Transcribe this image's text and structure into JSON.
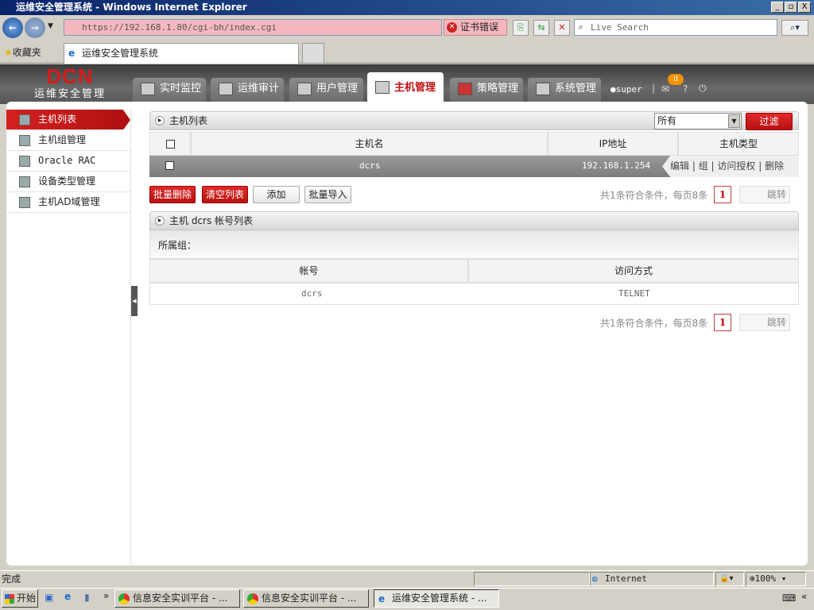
{
  "window": {
    "title": "运维安全管理系统 - Windows Internet Explorer",
    "min": "_",
    "max": "▫",
    "close": "X"
  },
  "browser": {
    "url": "https://192.168.1.80/cgi-bh/index.cgi",
    "cert_error": "证书错误",
    "search_placeholder": "Live Search",
    "favorites": "收藏夹",
    "tab_title": "运维安全管理系统"
  },
  "app": {
    "logo": "DCN",
    "subtitle": "运维安全管理",
    "nav": [
      {
        "label": "实时监控"
      },
      {
        "label": "运维审计"
      },
      {
        "label": "用户管理"
      },
      {
        "label": "主机管理"
      },
      {
        "label": "策略管理"
      },
      {
        "label": "系统管理"
      }
    ],
    "user": "super",
    "msg_count": "0",
    "help": "?"
  },
  "sidebar": {
    "items": [
      {
        "label": "主机列表"
      },
      {
        "label": "主机组管理"
      },
      {
        "label": "Oracle RAC"
      },
      {
        "label": "设备类型管理"
      },
      {
        "label": "主机AD域管理"
      }
    ]
  },
  "host_panel": {
    "title": "主机列表",
    "filter_value": "所有",
    "filter_btn": "过滤",
    "columns": [
      "主机名",
      "IP地址",
      "主机类型"
    ],
    "rows": [
      {
        "name": "dcrs",
        "ip": "192.168.1.254",
        "ops": [
          "编辑",
          "组",
          "访问授权",
          "删除"
        ]
      }
    ],
    "buttons": {
      "batch_delete": "批量删除",
      "clear": "清空列表",
      "add": "添加",
      "batch_import": "批量导入"
    },
    "pagination": {
      "summary": "共1条符合条件，每页8条",
      "page": "1",
      "jump": "跳转"
    }
  },
  "account_panel": {
    "title": "主机 dcrs 帐号列表",
    "group_label": "所属组：",
    "columns": [
      "帐号",
      "访问方式"
    ],
    "rows": [
      {
        "account": "dcrs",
        "method": "TELNET"
      }
    ],
    "pagination": {
      "summary": "共1条符合条件，每页8条",
      "page": "1",
      "jump": "跳转"
    }
  },
  "statusbar": {
    "status": "完成",
    "zone": "Internet",
    "zoom": "100%"
  },
  "taskbar": {
    "start": "开始",
    "tasks": [
      "信息安全实训平台 - ...",
      "信息安全实训平台 - ...",
      "运维安全管理系统 - ..."
    ]
  }
}
